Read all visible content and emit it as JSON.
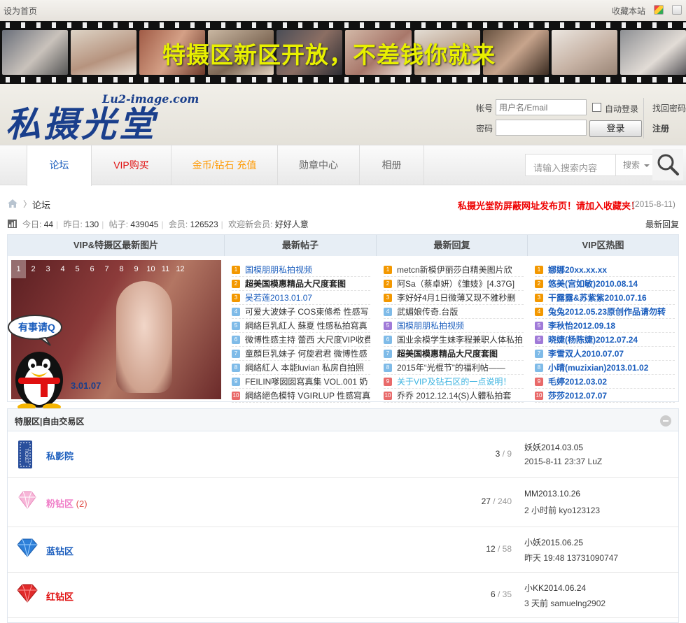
{
  "topbar": {
    "set_home": "设为首页",
    "favorite": "收藏本站"
  },
  "banner": {
    "slogan": "特摄区新区开放，不差钱你就来"
  },
  "logo": {
    "cn": "私摄光堂",
    "en": "Lu2-image.com"
  },
  "login": {
    "account_label": "帐号",
    "password_label": "密码",
    "account_placeholder": "用户名/Email",
    "auto_login": "自动登录",
    "login_button": "登录",
    "recover_password": "找回密码",
    "register": "注册"
  },
  "nav": {
    "tabs": [
      {
        "label": "论坛",
        "color": "#1a5dbd"
      },
      {
        "label": "VIP购买",
        "color": "#e01010"
      },
      {
        "label": "金币/钻石 充值",
        "color": "#ff9900"
      },
      {
        "label": "勋章中心",
        "color": "#666666"
      },
      {
        "label": "相册",
        "color": "#666666"
      }
    ],
    "search_placeholder": "请输入搜索内容",
    "search_type": "搜索"
  },
  "breadcrumb": {
    "arrow": "〉",
    "current": "论坛",
    "notice": "私摄光堂防屏蔽网址发布页！请加入收藏夹！",
    "date": "(2015-8-11)"
  },
  "stats": {
    "today_label": "今日:",
    "today": "44",
    "yesterday_label": "昨日:",
    "yesterday": "130",
    "posts_label": "帖子:",
    "posts": "439045",
    "members_label": "会员:",
    "members": "126523",
    "welcome_label": "欢迎新会员:",
    "welcome": "好好人意",
    "latest_reply": "最新回复"
  },
  "portal": {
    "headers": [
      "VIP&特摄区最新图片",
      "最新帖子",
      "最新回复",
      "VIP区热图"
    ],
    "slide_numbers": [
      "1",
      "2",
      "3",
      "4",
      "5",
      "6",
      "7",
      "8",
      "9",
      "10",
      "11",
      "12"
    ],
    "slide_caption": "3.01.07",
    "qq_bubble": "有事请Q",
    "latest_posts": [
      {
        "title": "国模朋朋私拍视频",
        "color": "#1a5dbd",
        "bold": false,
        "badge": "1",
        "badge_color": "#f39800"
      },
      {
        "title": "超美国模惠精品大尺度套图",
        "color": "#222222",
        "bold": true,
        "badge": "2",
        "badge_color": "#f39800"
      },
      {
        "title": "吴若莲2013.01.07",
        "color": "#1a5dbd",
        "bold": false,
        "badge": "3",
        "badge_color": "#f39800"
      },
      {
        "title": "可爱大波妹子 COS柬條希 性感写",
        "color": "#333333",
        "bold": false,
        "badge": "4",
        "badge_color": "#7fbbe8"
      },
      {
        "title": "網絡巨乳紅人 蘇夏 性感私拍寫真",
        "color": "#333333",
        "bold": false,
        "badge": "5",
        "badge_color": "#7fbbe8"
      },
      {
        "title": "微博性感主持 蕾西 大尺度VIP收費",
        "color": "#333333",
        "bold": false,
        "badge": "6",
        "badge_color": "#7fbbe8"
      },
      {
        "title": "童顏巨乳妹子 何旋君君 微博性感",
        "color": "#333333",
        "bold": false,
        "badge": "7",
        "badge_color": "#7fbbe8"
      },
      {
        "title": "網絡紅人 本能luvian 私房自拍照",
        "color": "#333333",
        "bold": false,
        "badge": "8",
        "badge_color": "#7fbbe8"
      },
      {
        "title": "FEILIN嗲囡囡寫真集 VOL.001 奶",
        "color": "#333333",
        "bold": false,
        "badge": "9",
        "badge_color": "#7fbbe8"
      },
      {
        "title": "網絡絕色模特 VGIRLUP 性感寫真",
        "color": "#333333",
        "bold": false,
        "badge": "10",
        "badge_color": "#e96a6a"
      }
    ],
    "latest_replies": [
      {
        "title": "metcn新模伊丽莎白精美图片欣",
        "color": "#333333",
        "bold": false,
        "badge": "1",
        "badge_color": "#f39800"
      },
      {
        "title": "阿Sa（蔡卓妍）《雏妓》[4.37G]",
        "color": "#333333",
        "bold": false,
        "badge": "2",
        "badge_color": "#f39800"
      },
      {
        "title": "李好好4月1日微薄又现不雅秒删",
        "color": "#333333",
        "bold": false,
        "badge": "3",
        "badge_color": "#f39800"
      },
      {
        "title": "武媚娘传奇.台版",
        "color": "#333333",
        "bold": false,
        "badge": "4",
        "badge_color": "#7fbbe8"
      },
      {
        "title": "国模朋朋私拍视频",
        "color": "#1a5dbd",
        "bold": false,
        "badge": "5",
        "badge_color": "#a07ad8"
      },
      {
        "title": "国业余模学生妹李程兼职人体私拍",
        "color": "#333333",
        "bold": false,
        "badge": "6",
        "badge_color": "#7fbbe8"
      },
      {
        "title": "超美国模惠精品大尺度套图",
        "color": "#222222",
        "bold": true,
        "badge": "7",
        "badge_color": "#7fbbe8"
      },
      {
        "title": "2015年“光棍节”的福利帖——",
        "color": "#333333",
        "bold": false,
        "badge": "8",
        "badge_color": "#7fbbe8"
      },
      {
        "title": "关于VIP及钻石区的一点说明！",
        "color": "#3bb3e0",
        "bold": false,
        "badge": "9",
        "badge_color": "#e96a6a"
      },
      {
        "title": "乔乔 2012.12.14(S)人體私拍套",
        "color": "#333333",
        "bold": false,
        "badge": "10",
        "badge_color": "#e96a6a"
      }
    ],
    "vip_hot": [
      {
        "title": "娜娜20xx.xx.xx",
        "color": "#1a5dbd",
        "bold": true,
        "badge": "1",
        "badge_color": "#f39800"
      },
      {
        "title": "悠美(宫如敏)2010.08.14",
        "color": "#1a5dbd",
        "bold": true,
        "badge": "2",
        "badge_color": "#f39800"
      },
      {
        "title": "干露露&苏紫紫2010.07.16",
        "color": "#1a5dbd",
        "bold": true,
        "badge": "3",
        "badge_color": "#f39800"
      },
      {
        "title": "兔兔2012.05.23原创作品请勿转",
        "color": "#1a5dbd",
        "bold": true,
        "badge": "4",
        "badge_color": "#f39800"
      },
      {
        "title": "李秋怡2012.09.18",
        "color": "#1a5dbd",
        "bold": true,
        "badge": "5",
        "badge_color": "#a07ad8"
      },
      {
        "title": "晓婕(杨陈婕)2012.07.24",
        "color": "#1a5dbd",
        "bold": true,
        "badge": "6",
        "badge_color": "#a07ad8"
      },
      {
        "title": "李雪双人2010.07.07",
        "color": "#1a5dbd",
        "bold": true,
        "badge": "7",
        "badge_color": "#7fbbe8"
      },
      {
        "title": "小晴(muzixian)2013.01.02",
        "color": "#1a5dbd",
        "bold": true,
        "badge": "8",
        "badge_color": "#7fbbe8"
      },
      {
        "title": "毛婷2012.03.02",
        "color": "#1a5dbd",
        "bold": true,
        "badge": "9",
        "badge_color": "#e96a6a"
      },
      {
        "title": "莎莎2012.07.07",
        "color": "#1a5dbd",
        "bold": true,
        "badge": "10",
        "badge_color": "#e96a6a"
      }
    ]
  },
  "forum": {
    "section_title": "特服区|自由交易区",
    "rows": [
      {
        "name": "私影院",
        "name_color": "#1a5dbd",
        "extra": "",
        "threads": "3",
        "posts": "9",
        "last_title": "妖妖2014.03.05",
        "last_meta": "2015-8-11 23:37 LuZ",
        "icon": "ticket-icon"
      },
      {
        "name": "粉钻区",
        "name_color": "#f07ec8",
        "extra": "(2)",
        "threads": "27",
        "posts": "240",
        "last_title": "MM2013.10.26",
        "last_meta": "2 小时前 kyo123123",
        "icon": "pink-diamond-icon"
      },
      {
        "name": "蓝钻区",
        "name_color": "#1a5dbd",
        "extra": "",
        "threads": "12",
        "posts": "58",
        "last_title": "小妖2015.06.25",
        "last_meta": "昨天 19:48 13731090747",
        "icon": "blue-diamond-icon"
      },
      {
        "name": "红钻区",
        "name_color": "#e01010",
        "extra": "",
        "threads": "6",
        "posts": "35",
        "last_title": "小KK2014.06.24",
        "last_meta": "3 天前 samuelng2902",
        "icon": "red-diamond-icon"
      }
    ]
  }
}
